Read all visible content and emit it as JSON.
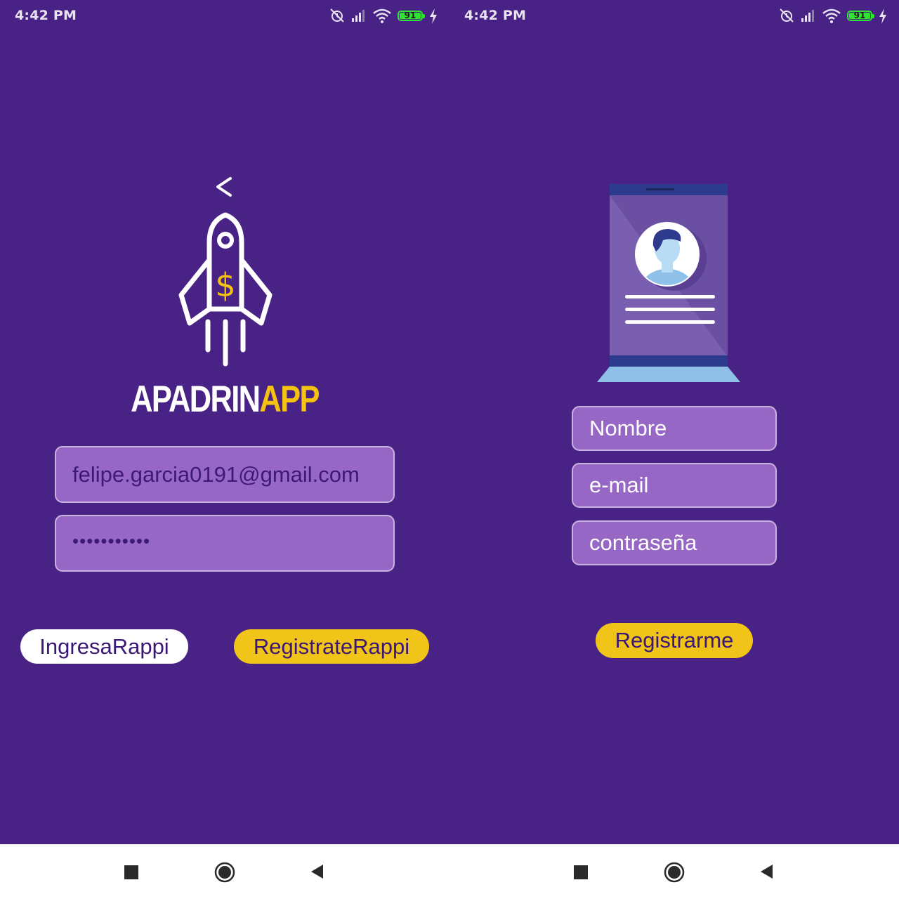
{
  "colors": {
    "background": "#482284",
    "field_fill": "#9767c5",
    "accent_yellow": "#f0c419",
    "white": "#ffffff",
    "battery_green": "#2fe32f"
  },
  "left_screen": {
    "status_bar": {
      "time": "4:42 PM",
      "battery_level": "91",
      "icons": [
        "muted-alarm-icon",
        "signal-icon",
        "wifi-icon",
        "battery-icon",
        "charging-icon"
      ]
    },
    "back_icon": "back-arrow-icon",
    "logo": {
      "icon": "rocket-dollar-icon",
      "title_part1": "APADRIN",
      "title_part2": "APP"
    },
    "email": {
      "value": "felipe.garcia0191@gmail.com"
    },
    "password": {
      "value": "•••••••••••"
    },
    "buttons": {
      "ingresa": "IngresaRappi",
      "registrate": "RegistrateRappi"
    }
  },
  "right_screen": {
    "status_bar": {
      "time": "4:42 PM",
      "battery_level": "91"
    },
    "illustration": "profile-card-phone-icon",
    "fields": {
      "name_placeholder": "Nombre",
      "email_placeholder": "e-mail",
      "password_placeholder": "contraseña"
    },
    "register_button": "Registrarme"
  },
  "nav_bar": {
    "icons": [
      "recent-apps-icon",
      "home-icon",
      "back-icon"
    ]
  }
}
